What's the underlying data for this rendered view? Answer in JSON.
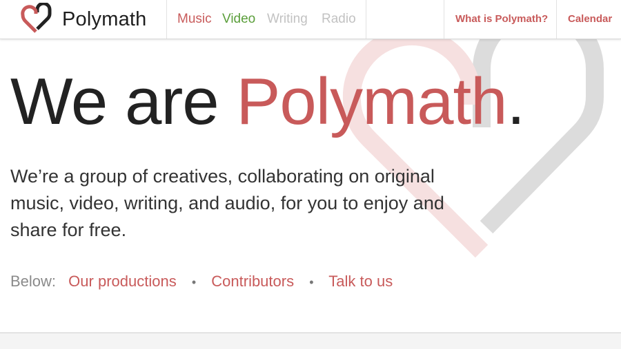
{
  "colors": {
    "accent": "#c85a5a",
    "video_green": "#5a9e3a",
    "muted_nav": "#c2c2c2",
    "heart_pink": "#f6e0e0",
    "heart_grey": "#dcdcdc"
  },
  "header": {
    "brand_name": "Polymath",
    "logo_icon": "heart-logo-icon",
    "nav_media": [
      {
        "label": "Music",
        "color": "#c85a5a"
      },
      {
        "label": "Video",
        "color": "#5a9e3a"
      },
      {
        "label": "Writing",
        "color": "#c2c2c2"
      },
      {
        "label": "Radio",
        "color": "#c2c2c2"
      }
    ],
    "nav_right": [
      {
        "label": "What is Polymath?"
      },
      {
        "label": "Calendar"
      }
    ]
  },
  "hero": {
    "title_prefix": "We are ",
    "title_accent": "Polymath",
    "title_suffix": ".",
    "description": "We’re a group of creatives, collaborating on original music, video, writing, and audio, for you to enjoy and share for free."
  },
  "below": {
    "label": "Below:",
    "links": [
      "Our productions",
      "Contributors",
      "Talk to us"
    ],
    "separator": "•"
  }
}
